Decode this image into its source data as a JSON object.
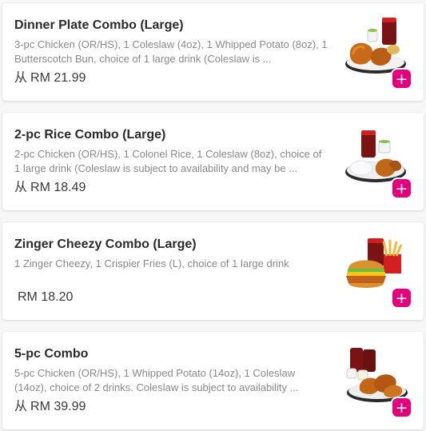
{
  "accent_color": "#e4007c",
  "items": [
    {
      "title": "Dinner Plate Combo (Large)",
      "description": "3-pc Chicken (OR/HS), 1 Coleslaw (4oz), 1 Whipped Potato (8oz), 1 Butterscotch Bun, choice of 1 large drink (Coleslaw is ...",
      "price_prefix": "从",
      "price": "RM 21.99",
      "image_icon": "dinner-plate-combo-image",
      "add_label": "+"
    },
    {
      "title": "2-pc Rice Combo (Large)",
      "description": "2-pc Chicken (OR/HS), 1 Colonel Rice, 1 Coleslaw (8oz), choice of 1 large drink (Coleslaw is subject to availability and may be ...",
      "price_prefix": "从",
      "price": "RM 18.49",
      "image_icon": "rice-combo-image",
      "add_label": "+"
    },
    {
      "title": "Zinger Cheezy Combo (Large)",
      "description": "1 Zinger Cheezy, 1 Crispier Fries (L), choice of 1 large drink",
      "price_prefix": "",
      "price": "RM 18.20",
      "image_icon": "burger-combo-image",
      "add_label": "+"
    },
    {
      "title": "5-pc Combo",
      "description": "5-pc Chicken (OR/HS), 1 Whipped Potato (14oz), 1 Coleslaw (14oz), choice of 2 drinks. Coleslaw is subject to availability ...",
      "price_prefix": "从",
      "price": "RM 39.99",
      "image_icon": "five-pc-combo-image",
      "add_label": "+"
    }
  ]
}
